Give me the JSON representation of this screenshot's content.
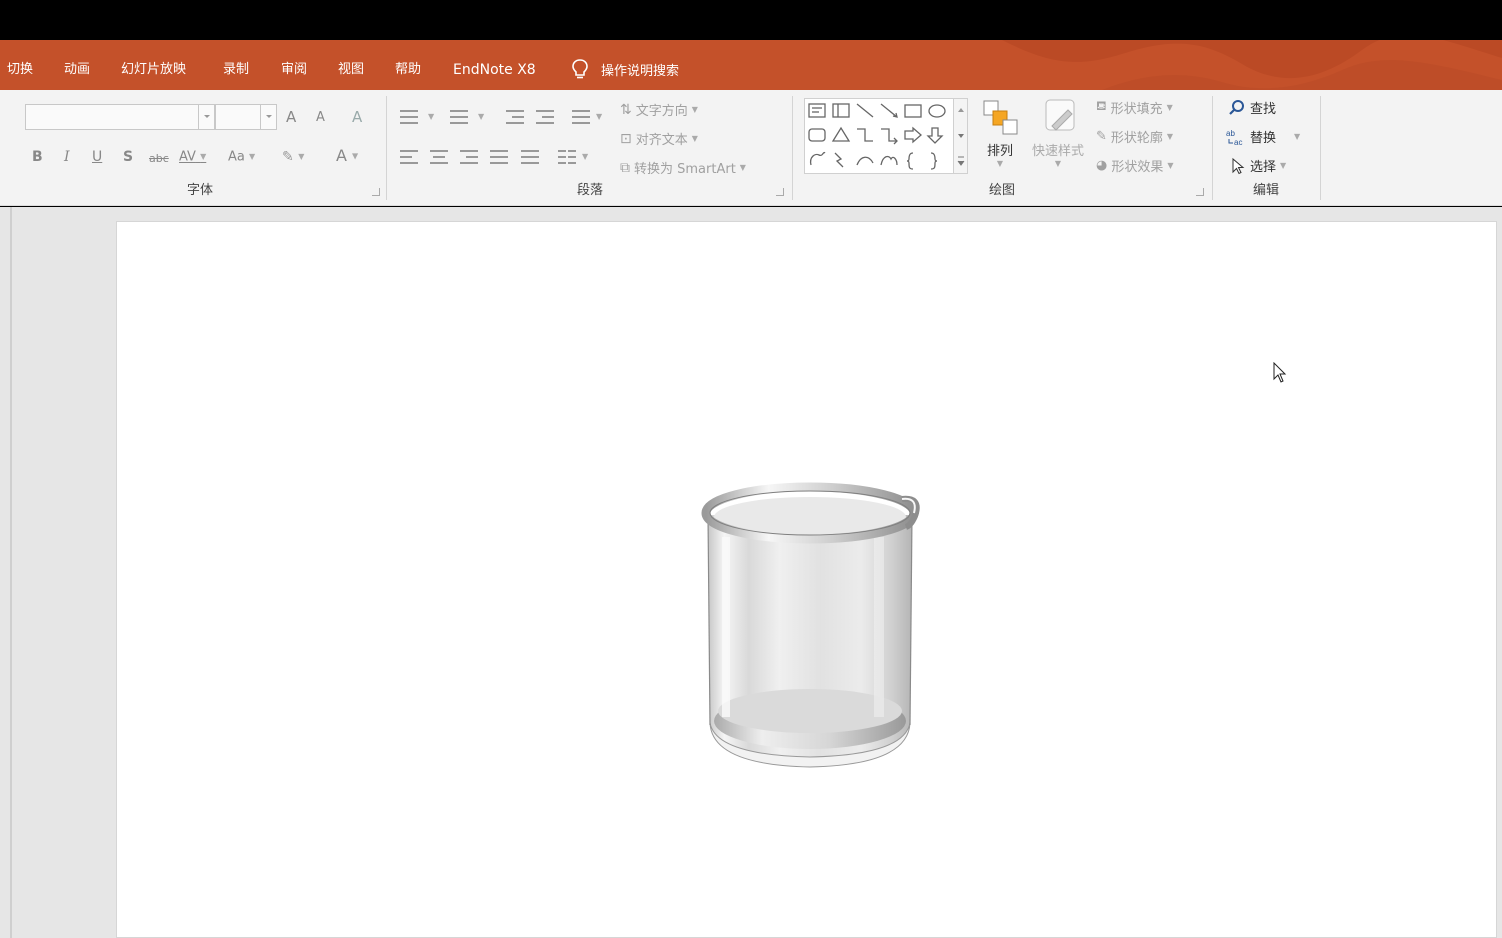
{
  "menu": {
    "tabs": [
      "切换",
      "动画",
      "幻灯片放映",
      "录制",
      "审阅",
      "视图",
      "帮助",
      "EndNote X8"
    ],
    "search_label": "操作说明搜索"
  },
  "ribbon": {
    "font": {
      "label": "字体",
      "font_name_value": "",
      "font_size_value": "",
      "grow_label": "A",
      "shrink_label": "A",
      "clear_label": "A",
      "bold": "B",
      "italic": "I",
      "underline": "U",
      "shadow": "S",
      "strike": "abc",
      "spacing": "AV",
      "case": "Aa",
      "color": "A"
    },
    "paragraph": {
      "label": "段落",
      "text_direction": "文字方向",
      "align_text": "对齐文本",
      "smartart": "转换为 SmartArt"
    },
    "drawing": {
      "label": "绘图",
      "arrange": "排列",
      "quick_styles": "快速样式",
      "shape_fill": "形状填充",
      "shape_outline": "形状轮廓",
      "shape_effects": "形状效果"
    },
    "editing": {
      "label": "编辑",
      "find": "查找",
      "replace": "替换",
      "select": "选择"
    }
  },
  "colors": {
    "menu_bg": "#c4512a",
    "ribbon_bg": "#f3f3f3",
    "workspace_bg": "#e6e6e6"
  }
}
